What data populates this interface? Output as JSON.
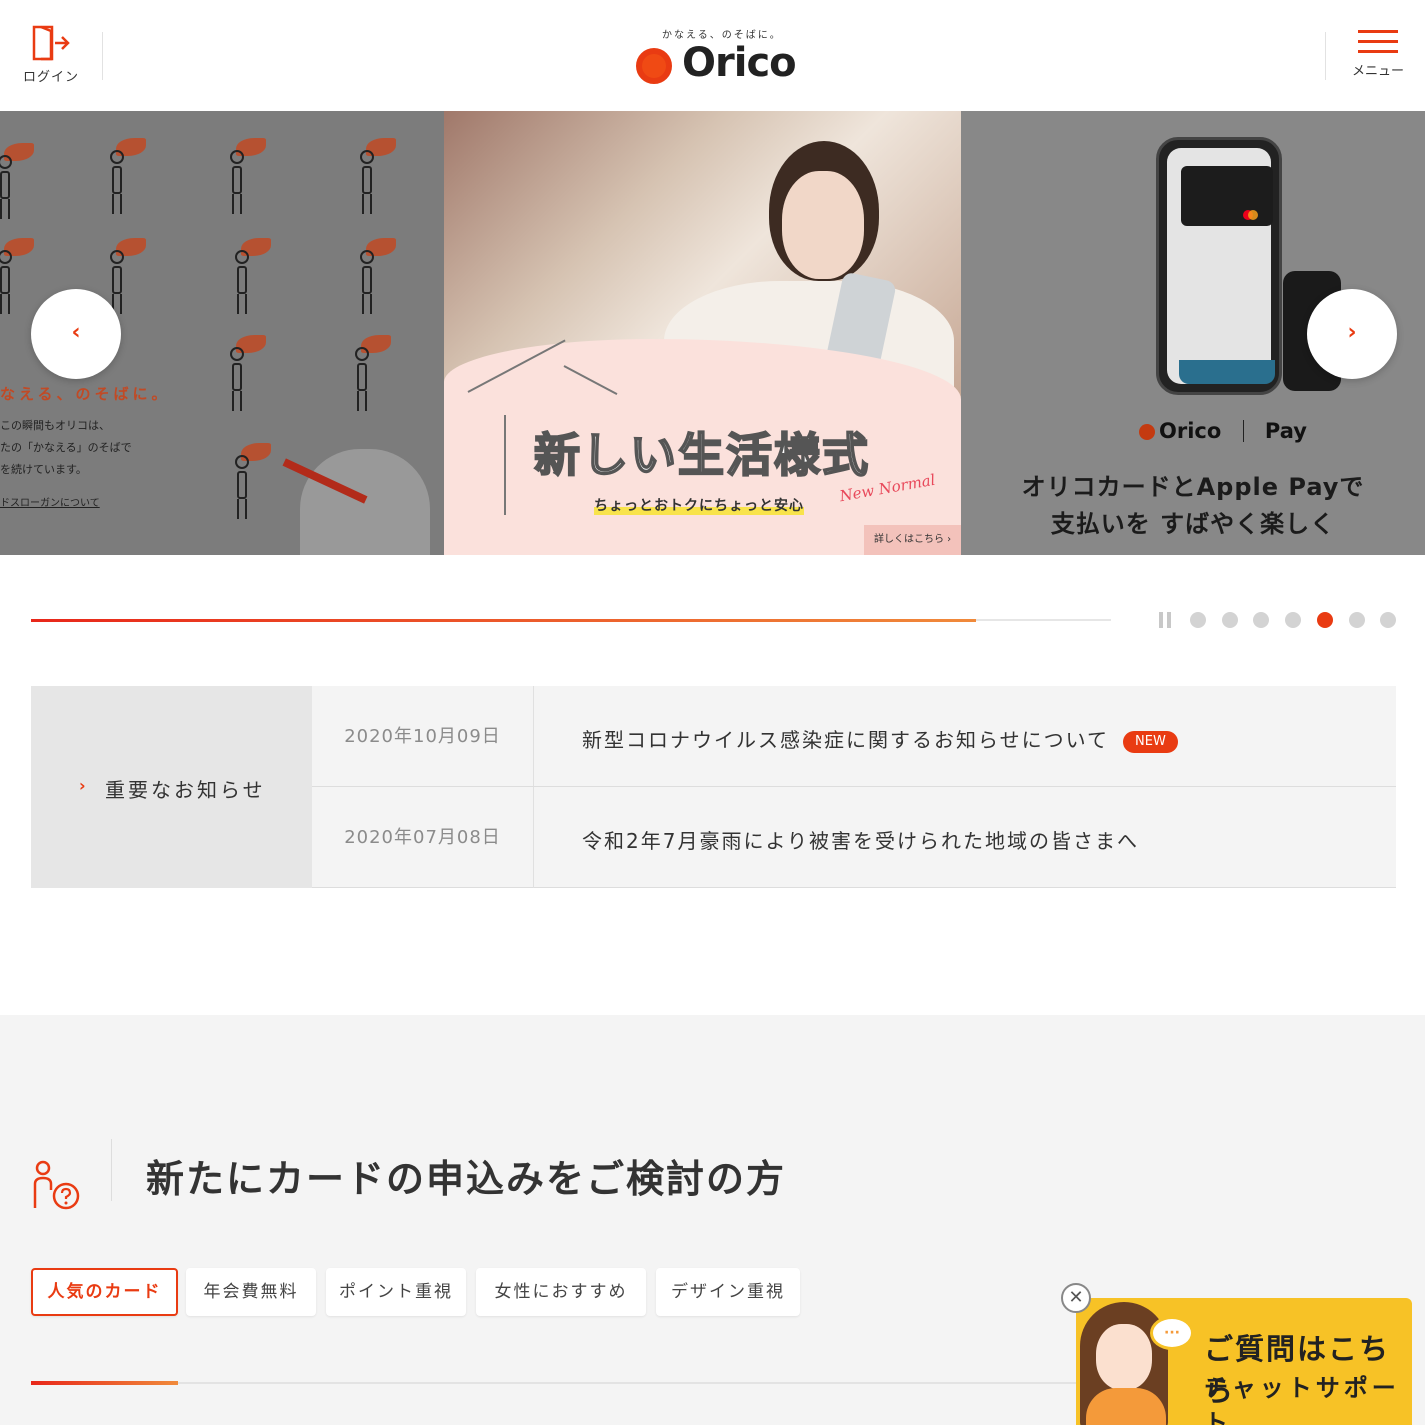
{
  "header": {
    "login_label": "ログイン",
    "logo_tagline": "かなえる、のそばに。",
    "logo_text": "Orico",
    "menu_label": "メニュー"
  },
  "slider": {
    "left_slide": {
      "slogan": "なえる、のそばに。",
      "body_lines": [
        "この瞬間もオリコは、",
        "たの「かなえる」のそばで",
        "を続けています。"
      ],
      "link": "ドスローガンについて"
    },
    "center_slide": {
      "headline": "新しい生活様式",
      "script_text": "New Normal",
      "subtext": "ちょっとおトクにちょっと安心",
      "detail_button": "詳しくはこちら ›"
    },
    "right_slide": {
      "brand_orico": "Orico",
      "brand_pay": "Pay",
      "line1": "オリコカードとApple Payで",
      "line2": "支払いを すばやく楽しく"
    },
    "prev_icon": "chevron-left-icon",
    "next_icon": "chevron-right-icon",
    "progress_fraction": 0.875,
    "dot_count": 7,
    "active_dot_index": 4
  },
  "notices": {
    "heading": "重要なお知らせ",
    "items": [
      {
        "date": "2020年10月09日",
        "title": "新型コロナウイルス感染症に関するお知らせについて",
        "badge": "NEW"
      },
      {
        "date": "2020年07月08日",
        "title": "令和2年7月豪雨により被害を受けられた地域の皆さまへ",
        "badge": ""
      }
    ]
  },
  "apply_section": {
    "title": "新たにカードの申込みをご検討の方",
    "tabs": [
      "人気のカード",
      "年会費無料",
      "ポイント重視",
      "女性におすすめ",
      "デザイン重視"
    ],
    "active_tab_index": 0
  },
  "chat": {
    "line1": "ご質問はこちら",
    "line2": "チャットサポート",
    "close_icon": "close-icon"
  },
  "colors": {
    "brand": "#e93b12",
    "chat_bg": "#f7c226"
  }
}
